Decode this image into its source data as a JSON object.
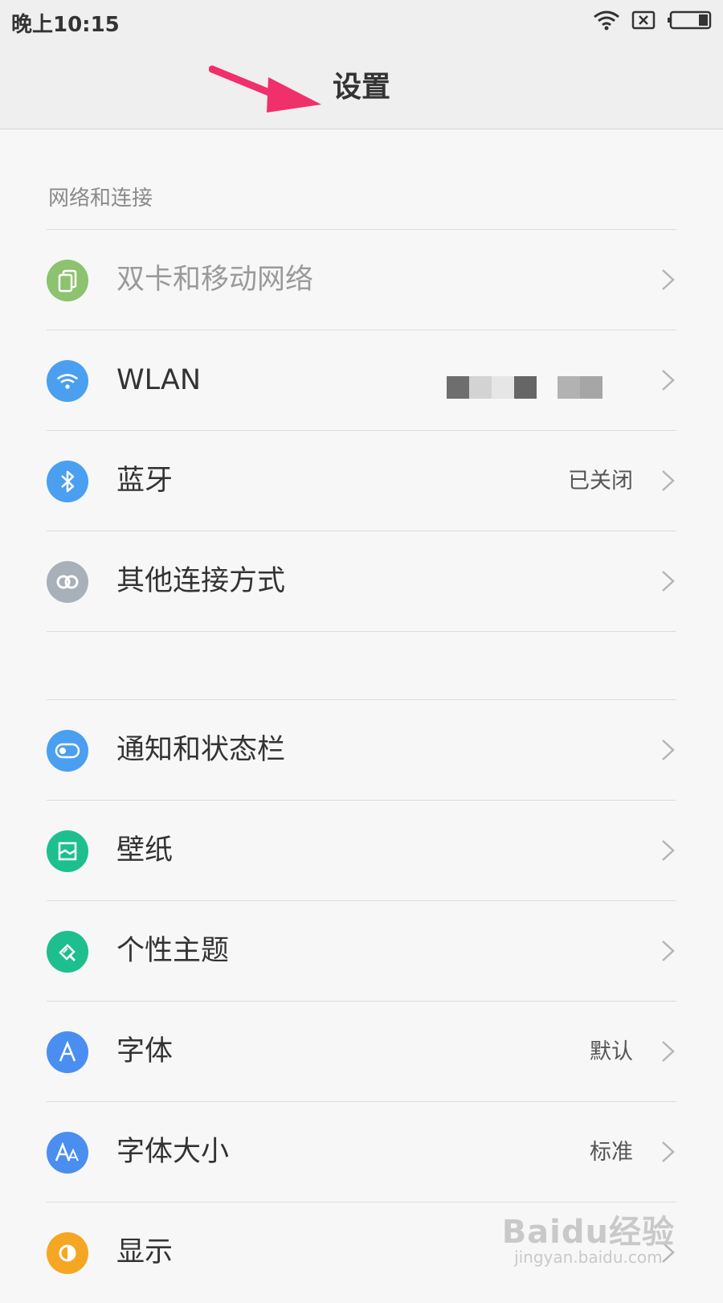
{
  "status_bar": {
    "time": "晚上10:15"
  },
  "header": {
    "title": "设置"
  },
  "sections": [
    {
      "label": "网络和连接"
    }
  ],
  "rows": [
    {
      "label": "双卡和移动网络",
      "value": "",
      "icon": "dual-sim-icon",
      "color": "#8dc26e",
      "dim": true
    },
    {
      "label": "WLAN",
      "value": "",
      "icon": "wifi-icon",
      "color": "#4a9ff0"
    },
    {
      "label": "蓝牙",
      "value": "已关闭",
      "icon": "bluetooth-icon",
      "color": "#4a9ff0"
    },
    {
      "label": "其他连接方式",
      "value": "",
      "icon": "link-icon",
      "color": "#a8b0ba"
    },
    {
      "label": "通知和状态栏",
      "value": "",
      "icon": "toggle-icon",
      "color": "#4a9ff0"
    },
    {
      "label": "壁纸",
      "value": "",
      "icon": "wallpaper-icon",
      "color": "#1dbf8f"
    },
    {
      "label": "个性主题",
      "value": "",
      "icon": "theme-brush-icon",
      "color": "#1dbf8f"
    },
    {
      "label": "字体",
      "value": "默认",
      "icon": "font-a-icon",
      "color": "#4a8ef0"
    },
    {
      "label": "字体大小",
      "value": "标准",
      "icon": "font-size-icon",
      "color": "#4a8ef0"
    },
    {
      "label": "显示",
      "value": "",
      "icon": "display-icon",
      "color": "#f5a623"
    }
  ],
  "watermark": {
    "brand": "Baidu经验",
    "url": "jingyan.baidu.com"
  }
}
